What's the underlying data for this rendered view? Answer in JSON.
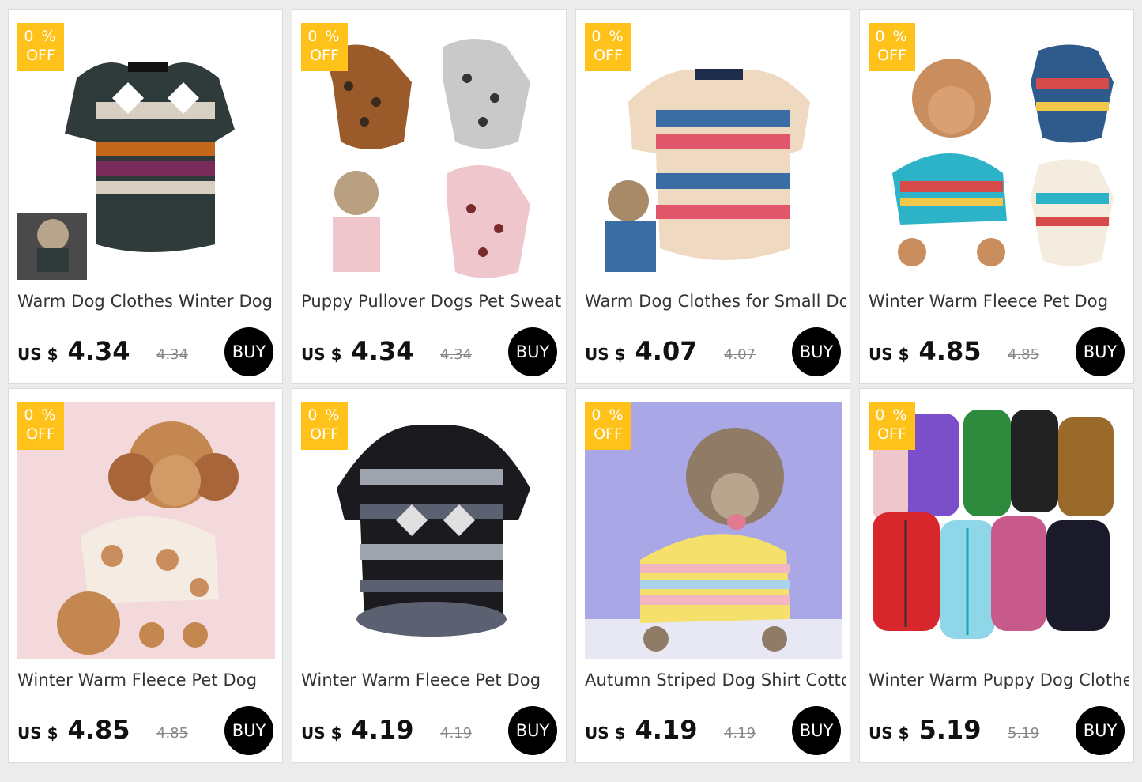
{
  "products": [
    {
      "badge_pct": "0 %",
      "badge_off": "OFF",
      "title": "Warm Dog Clothes Winter Dog",
      "currency": "US $",
      "price": "4.34",
      "old_price": "4.34",
      "buy": "BUY",
      "image": "aztec-fleece-sweater",
      "colors": [
        "#2f3b3a",
        "#d7d0c2",
        "#c2671c",
        "#7b2b5a"
      ]
    },
    {
      "badge_pct": "0 %",
      "badge_off": "OFF",
      "title": "Puppy Pullover Dogs Pet Sweater",
      "currency": "US $",
      "price": "4.34",
      "old_price": "4.34",
      "buy": "BUY",
      "image": "leopard-print-sweaters",
      "colors": [
        "#9a5a2a",
        "#c9c9c9",
        "#efc6cc",
        "#3a2a1e"
      ]
    },
    {
      "badge_pct": "0 %",
      "badge_off": "OFF",
      "title": "Warm Dog Clothes for Small Dog",
      "currency": "US $",
      "price": "4.07",
      "old_price": "4.07",
      "buy": "BUY",
      "image": "striped-aztec-sweater",
      "colors": [
        "#3a6da3",
        "#e0566a",
        "#efd9c0",
        "#1f2b4a"
      ]
    },
    {
      "badge_pct": "0 %",
      "badge_off": "OFF",
      "title": "Winter Warm Fleece Pet Dog",
      "currency": "US $",
      "price": "4.85",
      "old_price": "4.85",
      "buy": "BUY",
      "image": "poodle-aztec-sweater",
      "colors": [
        "#2cb3c7",
        "#d74a4a",
        "#f1c84a",
        "#c98d5e"
      ]
    },
    {
      "badge_pct": "0 %",
      "badge_off": "OFF",
      "title": "Winter Warm Fleece Pet Dog",
      "currency": "US $",
      "price": "4.85",
      "old_price": "4.85",
      "buy": "BUY",
      "image": "poodle-cream-bear-sweater",
      "colors": [
        "#f3d9dc",
        "#f4ece2",
        "#c4874f",
        "#a8653a"
      ]
    },
    {
      "badge_pct": "0 %",
      "badge_off": "OFF",
      "title": "Winter Warm Fleece Pet Dog",
      "currency": "US $",
      "price": "4.19",
      "old_price": "4.19",
      "buy": "BUY",
      "image": "dark-pattern-sweater",
      "colors": [
        "#1b1b1f",
        "#9ea3ad",
        "#5b6170",
        "#e0e0e0"
      ]
    },
    {
      "badge_pct": "0 %",
      "badge_off": "OFF",
      "title": "Autumn Striped Dog Shirt Cotton",
      "currency": "US $",
      "price": "4.19",
      "old_price": "4.19",
      "buy": "BUY",
      "image": "pastel-striped-shirt",
      "colors": [
        "#aaa7e6",
        "#f4e06a",
        "#f1b8c4",
        "#a9d2ec"
      ]
    },
    {
      "badge_pct": "0 %",
      "badge_off": "OFF",
      "title": "Winter Warm Puppy Dog Clothes",
      "currency": "US $",
      "price": "5.19",
      "old_price": "5.19",
      "buy": "BUY",
      "image": "padded-vests",
      "colors": [
        "#d8262d",
        "#8fd6e8",
        "#2e8b3d",
        "#222222"
      ]
    }
  ]
}
